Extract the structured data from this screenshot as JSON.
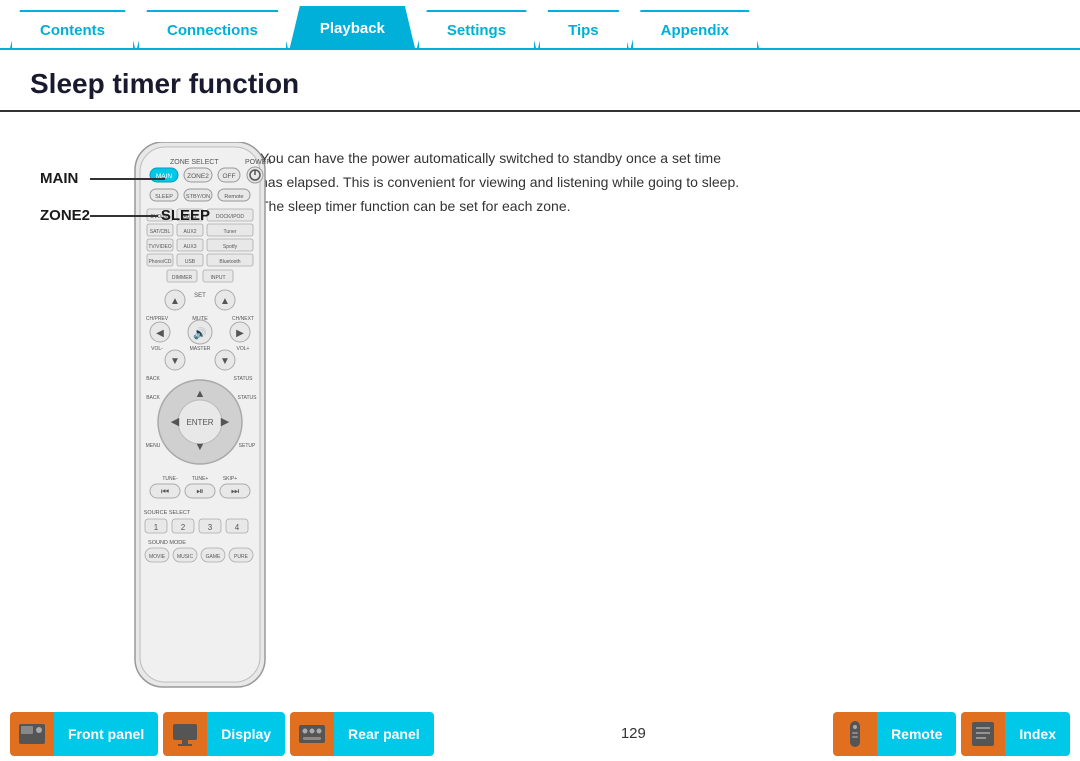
{
  "tabs": [
    {
      "label": "Contents",
      "active": false
    },
    {
      "label": "Connections",
      "active": false
    },
    {
      "label": "Playback",
      "active": true
    },
    {
      "label": "Settings",
      "active": false
    },
    {
      "label": "Tips",
      "active": false
    },
    {
      "label": "Appendix",
      "active": false
    }
  ],
  "page_title": "Sleep timer function",
  "description": "You can have the power automatically switched to standby once a set time has elapsed. This is convenient for viewing and listening while going to sleep. The sleep timer function can be set for each zone.",
  "labels": {
    "main": "MAIN",
    "zone2": "ZONE2",
    "sleep": "SLEEP"
  },
  "bottom_nav": {
    "page_number": "129",
    "buttons": [
      {
        "label": "Front panel",
        "icon": "◀"
      },
      {
        "label": "Display",
        "icon": "◀"
      },
      {
        "label": "Rear panel",
        "icon": "◀"
      },
      {
        "label": "Remote",
        "icon": "◀"
      },
      {
        "label": "Index",
        "icon": "◀"
      }
    ]
  }
}
